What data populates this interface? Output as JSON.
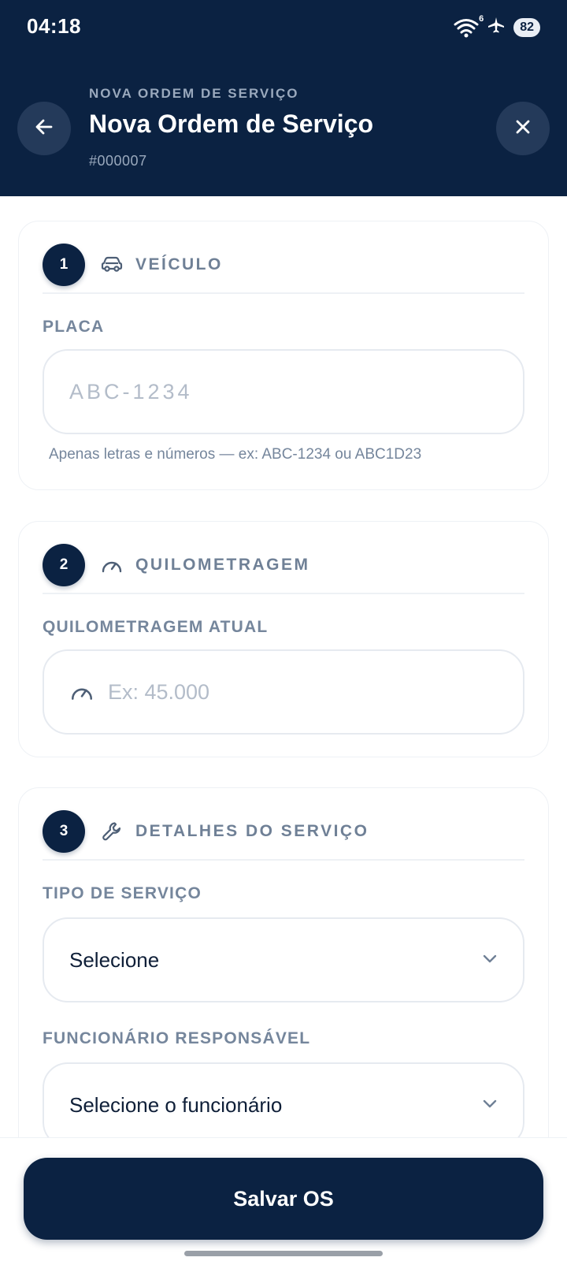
{
  "status_bar": {
    "time": "04:18",
    "wifi_badge": "6",
    "battery": "82"
  },
  "header": {
    "eyebrow": "NOVA ORDEM DE SERVIÇO",
    "title": "Nova Ordem de Serviço",
    "order_number": "#000007"
  },
  "sections": {
    "vehicle": {
      "step": "1",
      "title": "VEÍCULO",
      "icon": "car-icon",
      "plate_label": "PLACA",
      "plate_value": "",
      "plate_placeholder": "ABC-1234",
      "plate_hint": "Apenas letras e números — ex: ABC-1234 ou ABC1D23"
    },
    "mileage": {
      "step": "2",
      "title": "QUILOMETRAGEM",
      "icon": "speedometer-icon",
      "label": "QUILOMETRAGEM ATUAL",
      "value": "",
      "placeholder": "Ex: 45.000"
    },
    "details": {
      "step": "3",
      "title": "DETALHES DO SERVIÇO",
      "icon": "wrench-icon",
      "service_type_label": "TIPO DE SERVIÇO",
      "service_type_value": "Selecione",
      "employee_label": "FUNCIONÁRIO RESPONSÁVEL",
      "employee_value": "Selecione o funcionário"
    }
  },
  "footer": {
    "save_label": "Salvar OS"
  },
  "colors": {
    "primary": "#0b2242",
    "muted_text": "#75869c",
    "border": "#e6eaf0"
  }
}
